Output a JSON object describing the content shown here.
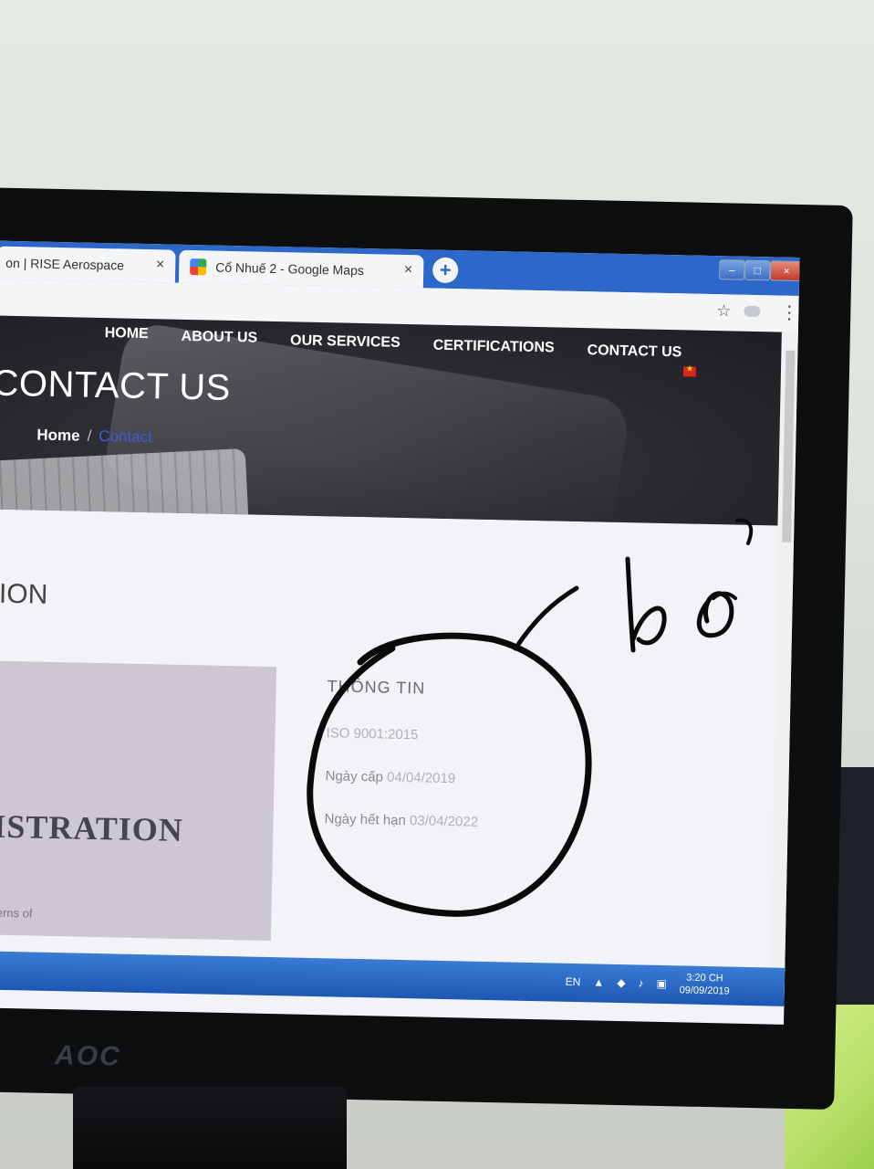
{
  "browser": {
    "tabs": [
      {
        "title": "on | RISE Aerospace",
        "close": "×"
      },
      {
        "title": "Cổ Nhuế 2 - Google Maps",
        "close": "×"
      }
    ],
    "new_tab": "+",
    "window_controls": {
      "minimize": "–",
      "maximize": "□",
      "close": "×"
    },
    "toolbar": {
      "bookmark_icon": "star-icon",
      "menu_icon": "kebab-menu-icon"
    }
  },
  "site": {
    "nav": [
      "HOME",
      "ABOUT US",
      "OUR SERVICES",
      "CERTIFICATIONS",
      "CONTACT US"
    ],
    "language_flag": "vietnam-flag-icon",
    "hero_title": "CONTACT US",
    "breadcrumb": {
      "home": "Home",
      "separator": "/",
      "current": "Contact"
    }
  },
  "content": {
    "section_heading_fragment": "TION",
    "registration_title_fragment": "GISTRATION",
    "registration_text_fragment": "nderns of",
    "info": {
      "heading": "THÔNG TIN",
      "standard": "ISO 9001:2015",
      "issued_label": "Ngày cấp",
      "issued_value": "04/04/2019",
      "expiry_label": "Ngày hết hạn",
      "expiry_value": "03/04/2022"
    }
  },
  "taskbar": {
    "language": "EN",
    "time": "3:20 CH",
    "date": "09/09/2019"
  },
  "monitor": {
    "brand": "AOC"
  },
  "annotation": {
    "handwritten_text": "bỏ"
  },
  "colors": {
    "taskbar": "#2a66c8",
    "accent_link": "#3e5bd6",
    "registration_box": "#ccc7d3"
  }
}
